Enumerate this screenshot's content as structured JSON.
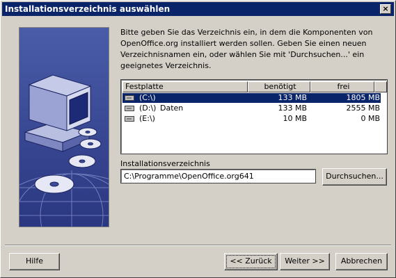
{
  "window": {
    "title": "Installationsverzeichnis auswählen",
    "close_glyph": "×"
  },
  "intro_text": "Bitte geben Sie das Verzeichnis ein, in dem die Komponenten von OpenOffice.org installiert werden sollen. Geben Sie einen neuen Verzeichnisnamen ein, oder wählen Sie mit 'Durchsuchen...' ein geeignetes Verzeichnis.",
  "drive_list": {
    "columns": [
      "Festplatte",
      "benötigt",
      "frei"
    ],
    "rows": [
      {
        "drive": "(C:\\)",
        "label": "",
        "needed": "133 MB",
        "free": "1805 MB",
        "selected": true
      },
      {
        "drive": "(D:\\)",
        "label": "Daten",
        "needed": "133 MB",
        "free": "2555 MB",
        "selected": false
      },
      {
        "drive": "(E:\\)",
        "label": "",
        "needed": "10 MB",
        "free": "0 MB",
        "selected": false
      }
    ]
  },
  "install_dir": {
    "label": "Installationsverzeichnis",
    "value": "C:\\Programme\\OpenOffice.org641"
  },
  "buttons": {
    "browse": "Durchsuchen...",
    "help": "Hilfe",
    "back": "<< Zurück",
    "next": "Weiter >>",
    "cancel": "Abbrechen"
  },
  "colors": {
    "titlebar": "#0a246a",
    "face": "#d4d0c8",
    "selection": "#0a246a",
    "art_background": "#3b4d99"
  },
  "icons": [
    "computer-cd-illustration",
    "hard-drive-icon",
    "close-icon"
  ]
}
